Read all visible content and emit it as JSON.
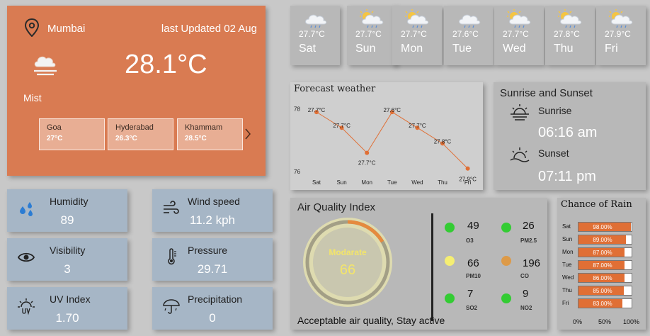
{
  "current": {
    "city": "Mumbai",
    "updated": "last Updated 02 Aug",
    "temp": "28.1°C",
    "condition": "Mist",
    "cities": [
      {
        "name": "Goa",
        "temp": "27°C"
      },
      {
        "name": "Hyderabad",
        "temp": "26.3°C"
      },
      {
        "name": "Khammam",
        "temp": "28.5°C"
      }
    ]
  },
  "metrics": {
    "humidity": {
      "label": "Humidity",
      "value": "89"
    },
    "visibility": {
      "label": "Visibility",
      "value": "3"
    },
    "uv": {
      "label": "UV Index",
      "value": "1.70"
    },
    "wind": {
      "label": "Wind speed",
      "value": "11.2 kph"
    },
    "pressure": {
      "label": "Pressure",
      "value": "29.71"
    },
    "precipitation": {
      "label": "Precipitation",
      "value": "0"
    }
  },
  "forecast": [
    {
      "day": "Sat",
      "temp": "27.7°C",
      "icon": "cloud-icon"
    },
    {
      "day": "Sun",
      "temp": "27.7°C",
      "icon": "partly-cloudy-icon"
    },
    {
      "day": "Mon",
      "temp": "27.7°C",
      "icon": "partly-cloudy-icon"
    },
    {
      "day": "Tue",
      "temp": "27.6°C",
      "icon": "cloud-icon"
    },
    {
      "day": "Wed",
      "temp": "27.7°C",
      "icon": "partly-cloudy-icon"
    },
    {
      "day": "Thu",
      "temp": "27.8°C",
      "icon": "partly-cloudy-icon"
    },
    {
      "day": "Fri",
      "temp": "27.9°C",
      "icon": "partly-cloudy-icon"
    }
  ],
  "chart_data": {
    "type": "line",
    "title": "Forecast weather",
    "categories": [
      "Sat",
      "Sun",
      "Mon",
      "Tue",
      "Wed",
      "Thu",
      "Fri"
    ],
    "values": [
      77.9,
      77.4,
      76.6,
      77.9,
      77.4,
      76.9,
      76.1
    ],
    "data_labels": [
      "27.7°C",
      "27.7°C",
      "27.7°C",
      "27.6°C",
      "27.7°C",
      "27.8°C",
      "27.9°C"
    ],
    "yticks": [
      "78",
      "76"
    ],
    "ylim": [
      75.8,
      78.4
    ],
    "color": "#e06f35"
  },
  "sun": {
    "title": "Sunrise and Sunset",
    "sunrise_label": "Sunrise",
    "sunrise": "06:16 am",
    "sunset_label": "Sunset",
    "sunset": "07:11 pm"
  },
  "aqi": {
    "title": "Air Quality Index",
    "status": "Modarate",
    "value": "66",
    "message": "Acceptable air quality, Stay active",
    "pollutants": [
      {
        "name": "O3",
        "value": "49",
        "color": "#33cc33"
      },
      {
        "name": "PM2.5",
        "value": "26",
        "color": "#33cc33"
      },
      {
        "name": "PM10",
        "value": "66",
        "color": "#f5ee72"
      },
      {
        "name": "CO",
        "value": "196",
        "color": "#dd9a48"
      },
      {
        "name": "SO2",
        "value": "7",
        "color": "#33cc33"
      },
      {
        "name": "NO2",
        "value": "9",
        "color": "#33cc33"
      }
    ]
  },
  "rain": {
    "title": "Chance of Rain",
    "days": [
      {
        "day": "Sat",
        "pct": 98,
        "label": "98.00%"
      },
      {
        "day": "Sun",
        "pct": 89,
        "label": "89.00%"
      },
      {
        "day": "Mon",
        "pct": 87,
        "label": "87.00%"
      },
      {
        "day": "Tue",
        "pct": 87,
        "label": "87.00%"
      },
      {
        "day": "Wed",
        "pct": 86,
        "label": "86.00%"
      },
      {
        "day": "Thu",
        "pct": 85,
        "label": "85.00%"
      },
      {
        "day": "Fri",
        "pct": 83,
        "label": "83.00%"
      }
    ],
    "axis": [
      "0%",
      "50%",
      "100%"
    ]
  }
}
